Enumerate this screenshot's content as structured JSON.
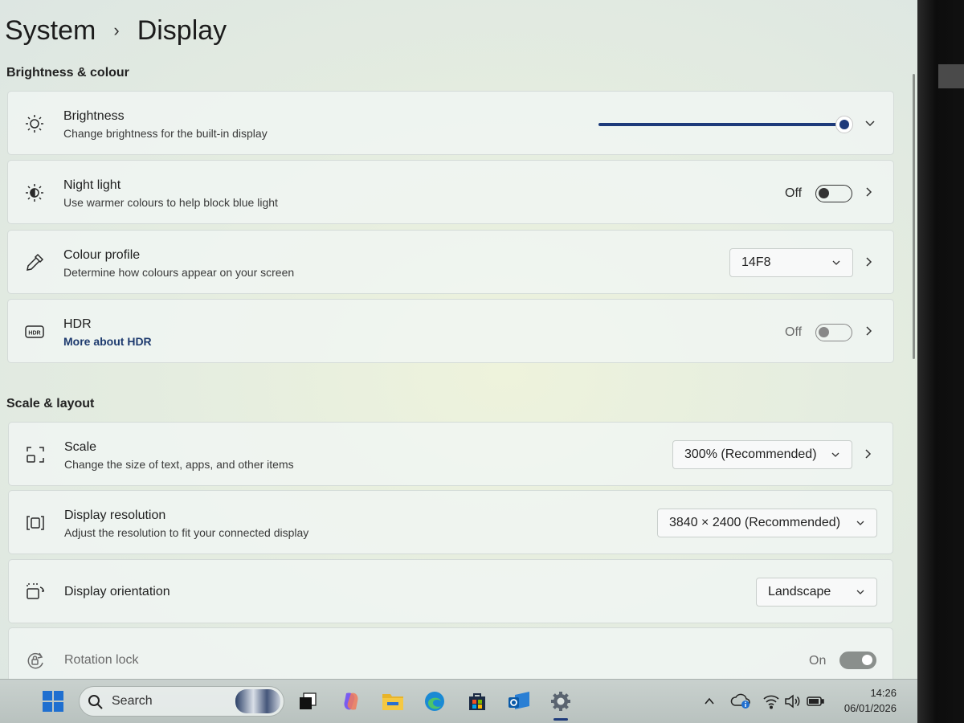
{
  "breadcrumb": {
    "parent": "System",
    "separator": "›",
    "current": "Display"
  },
  "sections": {
    "brightness_colour": "Brightness & colour",
    "scale_layout": "Scale & layout"
  },
  "brightness": {
    "title": "Brightness",
    "desc": "Change brightness for the built-in display",
    "level_percent": 100
  },
  "night_light": {
    "title": "Night light",
    "desc": "Use warmer colours to help block blue light",
    "state": "Off"
  },
  "colour_profile": {
    "title": "Colour profile",
    "desc": "Determine how colours appear on your screen",
    "value": "14F8"
  },
  "hdr": {
    "title": "HDR",
    "link": "More about HDR",
    "state": "Off"
  },
  "scale": {
    "title": "Scale",
    "desc": "Change the size of text, apps, and other items",
    "value": "300% (Recommended)"
  },
  "resolution": {
    "title": "Display resolution",
    "desc": "Adjust the resolution to fit your connected display",
    "value": "3840 × 2400 (Recommended)"
  },
  "orientation": {
    "title": "Display orientation",
    "value": "Landscape"
  },
  "rotation_lock": {
    "title": "Rotation lock",
    "state": "On"
  },
  "taskbar": {
    "search_label": "Search",
    "time": "14:26",
    "date": "06/01/2026",
    "accent_color": "#1d3a7a"
  }
}
